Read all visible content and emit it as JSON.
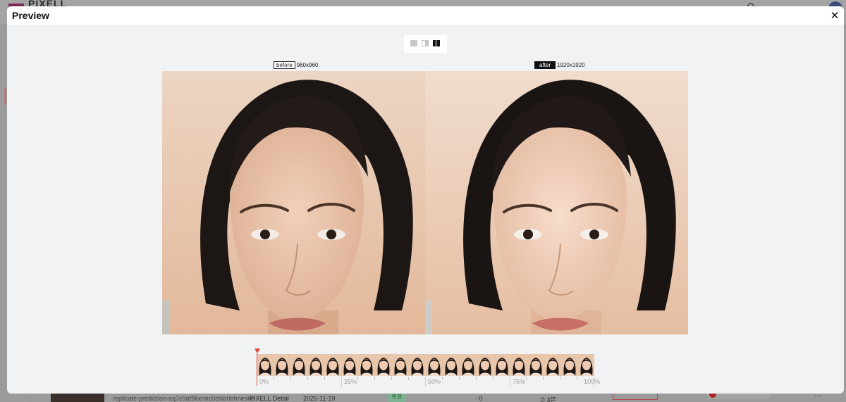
{
  "app": {
    "logo_text": "PIXELL",
    "row": {
      "file_name": "replicate-prediction-eq7c9at9kxrmc0ctkb0bhneskc",
      "link_label": "PIXELL Detail",
      "date": "2025-11-19",
      "status_badge": "완료",
      "cost": "- 0",
      "duration": "⏱ 3분",
      "more": "···"
    }
  },
  "modal": {
    "title": "Preview",
    "close_symbol": "✕",
    "view_modes": [
      "single",
      "split-slider",
      "side-by-side"
    ],
    "active_view_mode": "side-by-side",
    "before": {
      "tag": "before",
      "dimensions": "960x960"
    },
    "after": {
      "tag": "after",
      "dimensions": "1920x1920"
    },
    "timeline": {
      "position_percent": 0,
      "frame_count": 20,
      "ticks": [
        "0%",
        "25%",
        "50%",
        "75%",
        "100%"
      ]
    }
  },
  "colors": {
    "overlay": "#9b9b9b",
    "modal_bg": "#f1f2f4",
    "timeline_marker": "#e2483a",
    "skin_bg_before": "#e9c7ad",
    "skin_bg_after": "#efd2bc"
  }
}
